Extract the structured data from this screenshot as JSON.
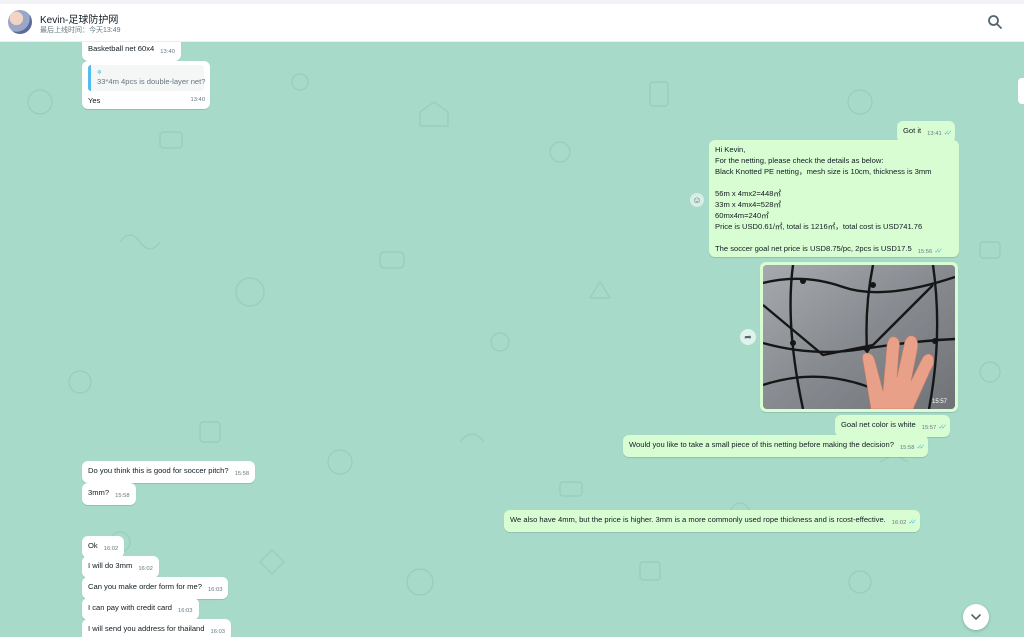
{
  "header": {
    "contact_name": "Kevin-足球防护网",
    "last_seen": "最后上线时间：今天13:49",
    "search_icon": "search-icon"
  },
  "messages": {
    "m1": {
      "text": "Basketball net 60x4",
      "time": "13:40"
    },
    "m2": {
      "quote": "33*4m 4pcs is double-layer net?",
      "text": "Yes",
      "time": "13:40"
    },
    "m3": {
      "text": "Got it",
      "time": "13:41"
    },
    "m4": {
      "lines": [
        "Hi Kevin,",
        "For the netting, please check the details as below:",
        "Black Knotted PE netting，mesh size is 10cm, thickness is 3mm",
        "",
        "56m x 4mx2=448㎡",
        "33m x 4mx4=528㎡",
        "60mx4m=240㎡",
        "Price is USD0.61/㎡, total is 1216㎡，total cost is USD741.76",
        ""
      ],
      "last_line": "The soccer goal net price is USD8.75/pc, 2pcs is USD17.5",
      "time": "15:56"
    },
    "m5": {
      "time": "15:57"
    },
    "m6": {
      "text": "Goal net color is white",
      "time": "15:57"
    },
    "m7": {
      "text": "Would you like to take a small piece of this netting before making the decision?",
      "time": "15:58"
    },
    "m8": {
      "text": "Do you think this is good for soccer pitch?",
      "time": "15:58"
    },
    "m9": {
      "text": "3mm?",
      "time": "15:58"
    },
    "m10": {
      "text": "We also have 4mm, but the price is higher. 3mm is a more commonly used rope thickness and is rcost-effective.",
      "time": "16:02"
    },
    "m11": {
      "text": "Ok",
      "time": "16:02"
    },
    "m12": {
      "text": "I will do 3mm",
      "time": "16:02"
    },
    "m13": {
      "text": "Can you make order form for me?",
      "time": "16:03"
    },
    "m14": {
      "text": "I can pay with credit card",
      "time": "16:03"
    },
    "m15": {
      "text": "I will send you address for thailand",
      "time": "16:03"
    }
  },
  "colors": {
    "chat_background": "#a7dac8",
    "incoming_bubble": "#ffffff",
    "outgoing_bubble": "#d9fdd3",
    "read_ticks": "#53bdeb"
  }
}
